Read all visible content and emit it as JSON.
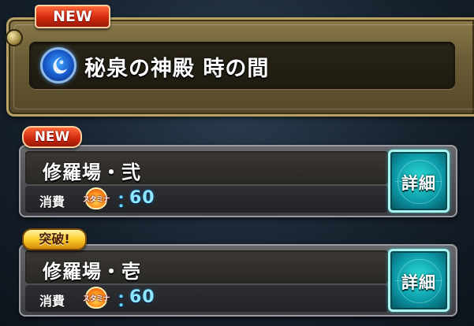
{
  "header": {
    "new_badge": "NEW",
    "title": "秘泉の神殿 時の間",
    "icon": "water-orb-icon"
  },
  "stages": [
    {
      "badge": "NEW",
      "name": "修羅場・弐",
      "cost_label": "消費",
      "stamina_label": "スタミナ",
      "cost_colon": "：",
      "cost_value": "60",
      "detail_label": "詳細"
    },
    {
      "badge": "突破!",
      "name": "修羅場・壱",
      "cost_label": "消費",
      "stamina_label": "スタミナ",
      "cost_colon": "：",
      "cost_value": "60",
      "detail_label": "詳細"
    }
  ],
  "colors": {
    "accent_gold": "#b8a364",
    "detail_teal": "#0c9aa8",
    "cost_cyan": "#8ee6ff",
    "new_red": "#d22b10"
  }
}
